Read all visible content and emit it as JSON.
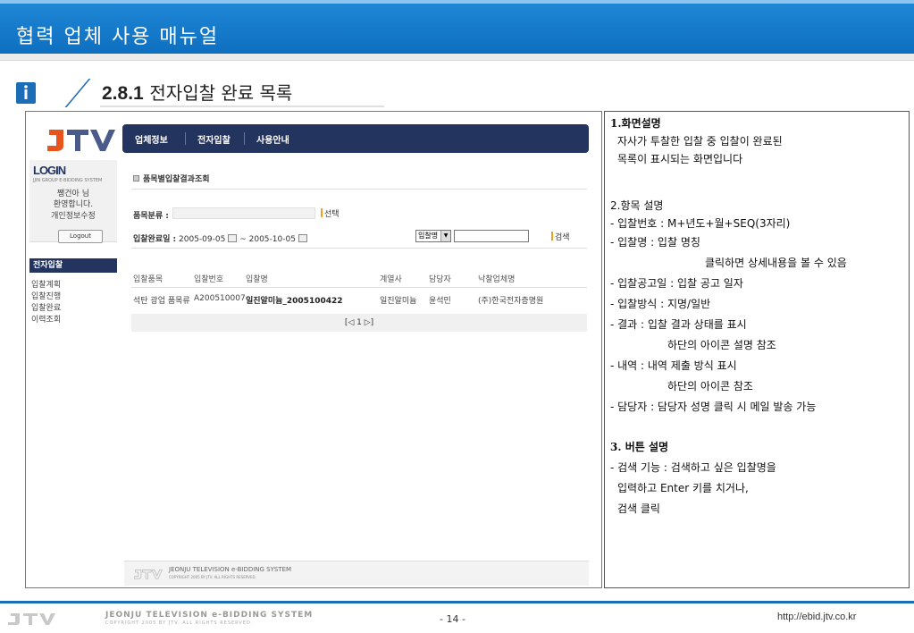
{
  "header": {
    "title": "협력 업체 사용 매뉴얼"
  },
  "section": {
    "number": "2.8.1",
    "title": "전자입찰 완료 목록"
  },
  "app": {
    "nav": [
      "업체정보",
      "전자입찰",
      "사용안내"
    ],
    "login": {
      "title": "LOGIN",
      "subtitle": "JJIN GROUP E-BIDDING SYSTEM",
      "user": "쨍건아 님",
      "welcome": "환영합니다.",
      "edit": "개인정보수정",
      "logout": "Logout"
    },
    "menu_head": "전자입찰",
    "menu": [
      "입찰계획",
      "입찰진행",
      "입찰완료",
      "이력조회"
    ],
    "page_title": "품목별입찰결과조회",
    "form": {
      "category_label": "품목분류 :",
      "select_btn": "선택",
      "date_label": "입찰완료일 :",
      "date_from": "2005-09-05",
      "date_sep": "~",
      "date_to": "2005-10-05",
      "search_type": "입찰명",
      "search_btn": "검색"
    },
    "table": {
      "headers": [
        "입찰품목",
        "입찰번호",
        "입찰명",
        "계열사",
        "담당자",
        "낙찰업체명"
      ],
      "rows": [
        [
          "석탄 광업 품목류",
          "A200510007",
          "일진알미늄_2005100422",
          "일진알미늄",
          "윤석민",
          "(주)한국전자증명원"
        ]
      ]
    },
    "pager": "[◁ 1 ▷]",
    "footer_title": "JEONJU TELEVISION e-BIDDING SYSTEM",
    "footer_copy": "COPYRIGHT 2005 BY JTV. ALL RIGHTS RESERVED."
  },
  "description": {
    "s1_title": "1.화면설명",
    "s1_lines": [
      "자사가 투찰한 입찰 중 입찰이 완료된",
      "목록이 표시되는 화면입니다"
    ],
    "s2_title": "2.항목 설명",
    "s2_lines": [
      "- 입찰번호 : M+년도+월+SEQ(3자리)",
      "- 입찰명 : 입찰 명칭",
      "클릭하면 상세내용을 볼 수 있음",
      "- 입찰공고일 : 입찰 공고 일자",
      "- 입찰방식 : 지명/일반",
      "- 결과 : 입찰 결과 상태를 표시",
      "하단의 아이콘 설명 참조",
      "- 내역 : 내역 제출 방식 표시",
      "하단의 아이콘 참조",
      "- 담당자 : 담당자 성명 클릭 시 메일 발송 가능"
    ],
    "s3_title": "3. 버튼 설명",
    "s3_lines": [
      "- 검색 기능 : 검색하고 싶은 입찰명을",
      "입력하고 Enter 키를 치거나,",
      "검색 클릭"
    ]
  },
  "footer": {
    "system": "JEONJU TELEVISION e-BIDDING SYSTEM",
    "copyright": "COPYRIGHT 2005 BY JTV. ALL RIGHTS RESERVED.",
    "page": "- 14 -",
    "url": "http://ebid.jtv.co.kr"
  }
}
